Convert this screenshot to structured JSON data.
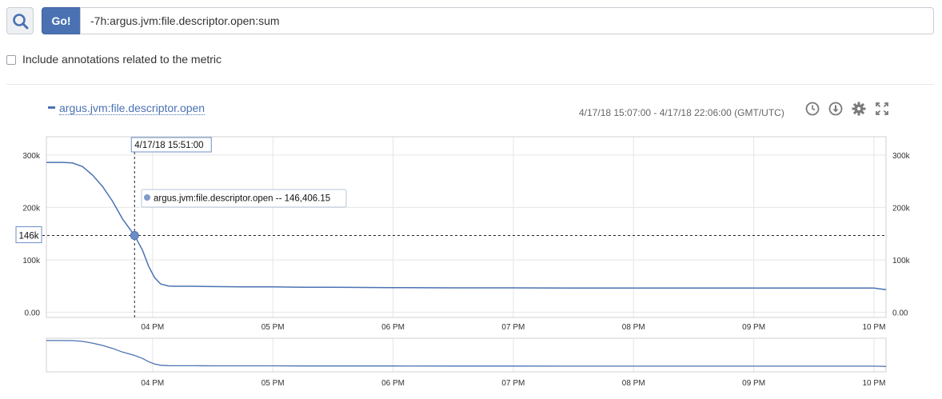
{
  "search": {
    "go_label": "Go!",
    "query": "-7h:argus.jvm:file.descriptor.open:sum"
  },
  "annotations": {
    "label": "Include annotations related to the metric",
    "checked": false
  },
  "chart_header": {
    "date_range": "4/17/18 15:07:00 - 4/17/18 22:06:00 (GMT/UTC)"
  },
  "toolbar": {
    "icons": [
      "clock-icon",
      "download-icon",
      "gear-icon",
      "fullscreen-icon"
    ]
  },
  "colors": {
    "series": "#4a72b3",
    "grid": "#e6e6e6",
    "button": "#4a72b3"
  },
  "tooltip": {
    "time": "4/17/18 15:51:00",
    "text": "argus.jvm:file.descriptor.open -- 146,406.15",
    "y_label": "146k",
    "x": "15:51",
    "y": 146406.15
  },
  "chart_data": {
    "type": "line",
    "title": "",
    "xlabel": "",
    "ylabel": "",
    "legend_position": "top-left",
    "grid": true,
    "x_range": [
      "15:07",
      "22:06"
    ],
    "ylim": [
      -10000,
      335000
    ],
    "x_ticks": [
      "04 PM",
      "05 PM",
      "06 PM",
      "07 PM",
      "08 PM",
      "09 PM",
      "10 PM"
    ],
    "y_ticks_left": [
      "0.00",
      "100k",
      "200k",
      "300k"
    ],
    "y_ticks_right": [
      "0.00",
      "100k",
      "200k",
      "300k"
    ],
    "series": [
      {
        "name": "argus.jvm:file.descriptor.open",
        "color": "#4a72b3",
        "points": [
          [
            "15:07",
            286000
          ],
          [
            "15:15",
            286000
          ],
          [
            "15:20",
            285000
          ],
          [
            "15:25",
            278000
          ],
          [
            "15:30",
            262000
          ],
          [
            "15:35",
            240000
          ],
          [
            "15:40",
            212000
          ],
          [
            "15:45",
            178000
          ],
          [
            "15:51",
            146406
          ],
          [
            "15:55",
            118000
          ],
          [
            "15:58",
            88000
          ],
          [
            "16:01",
            66000
          ],
          [
            "16:04",
            54000
          ],
          [
            "16:08",
            50000
          ],
          [
            "16:12",
            49500
          ],
          [
            "16:20",
            49500
          ],
          [
            "16:30",
            49000
          ],
          [
            "16:45",
            48500
          ],
          [
            "17:00",
            48500
          ],
          [
            "17:15",
            47500
          ],
          [
            "17:30",
            47500
          ],
          [
            "18:00",
            47000
          ],
          [
            "18:30",
            46500
          ],
          [
            "19:00",
            46500
          ],
          [
            "19:30",
            46000
          ],
          [
            "20:00",
            46000
          ],
          [
            "20:30",
            46000
          ],
          [
            "21:00",
            46000
          ],
          [
            "21:30",
            46000
          ],
          [
            "22:00",
            46000
          ],
          [
            "22:04",
            44000
          ],
          [
            "22:06",
            43000
          ]
        ]
      }
    ]
  }
}
